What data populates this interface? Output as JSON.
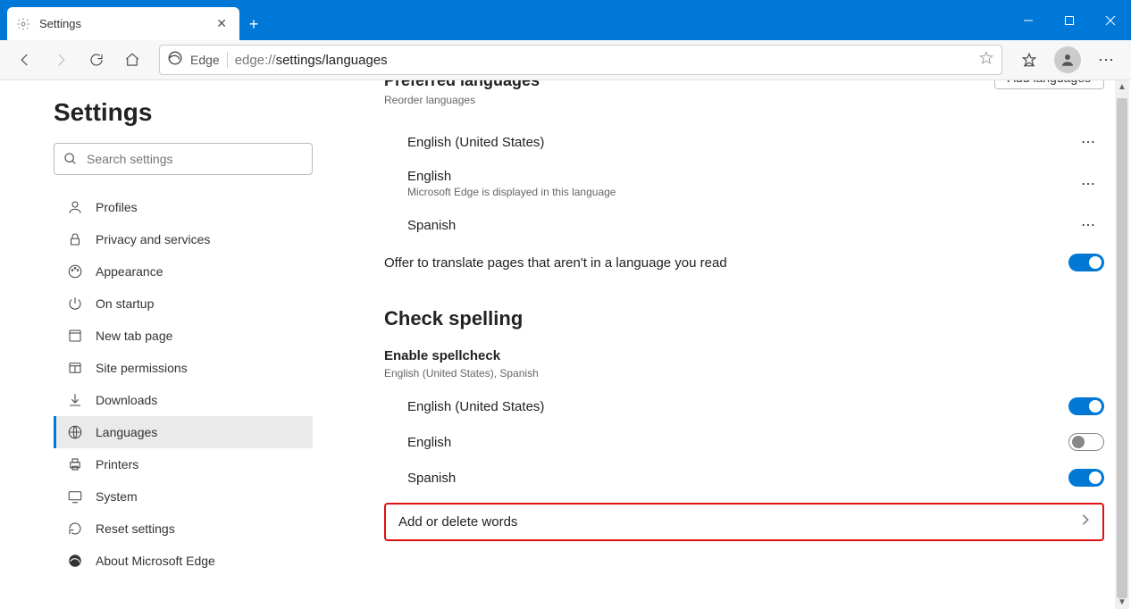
{
  "tab": {
    "title": "Settings"
  },
  "address": {
    "label": "Edge",
    "prefix": "edge://",
    "bold": "settings/languages"
  },
  "sidebar": {
    "heading": "Settings",
    "search_placeholder": "Search settings",
    "items": [
      {
        "label": "Profiles"
      },
      {
        "label": "Privacy and services"
      },
      {
        "label": "Appearance"
      },
      {
        "label": "On startup"
      },
      {
        "label": "New tab page"
      },
      {
        "label": "Site permissions"
      },
      {
        "label": "Downloads"
      },
      {
        "label": "Languages"
      },
      {
        "label": "Printers"
      },
      {
        "label": "System"
      },
      {
        "label": "Reset settings"
      },
      {
        "label": "About Microsoft Edge"
      }
    ]
  },
  "preferred": {
    "title": "Preferred languages",
    "sub": "Reorder languages",
    "add_btn": "Add languages",
    "langs": [
      {
        "name": "English (United States)",
        "sub": ""
      },
      {
        "name": "English",
        "sub": "Microsoft Edge is displayed in this language"
      },
      {
        "name": "Spanish",
        "sub": ""
      }
    ],
    "translate_label": "Offer to translate pages that aren't in a language you read"
  },
  "spell": {
    "heading": "Check spelling",
    "enable_label": "Enable spellcheck",
    "enable_sub": "English (United States), Spanish",
    "langs": [
      {
        "name": "English (United States)",
        "on": true
      },
      {
        "name": "English",
        "on": false
      },
      {
        "name": "Spanish",
        "on": true
      }
    ],
    "add_words": "Add or delete words"
  }
}
